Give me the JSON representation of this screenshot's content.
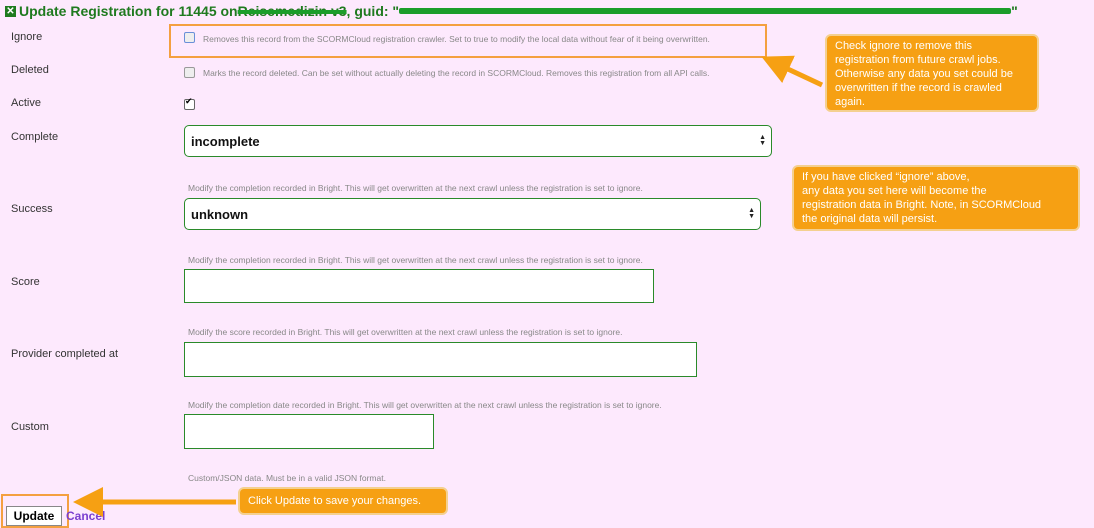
{
  "title": {
    "prefix": "Update Registration for 11445 on ",
    "course": "Reisemedizin v3",
    "guid_label": ", guid: \"",
    "guid_suffix": "\""
  },
  "fields": {
    "ignore": {
      "label": "Ignore",
      "hint": "Removes this record from the SCORMCloud registration crawler. Set to true to modify the local data without fear of it being overwritten.",
      "checked": false
    },
    "deleted": {
      "label": "Deleted",
      "hint": "Marks the record deleted. Can be set without actually deleting the record in SCORMCloud. Removes this registration from all API calls.",
      "checked": false
    },
    "active": {
      "label": "Active",
      "checked": true
    },
    "complete": {
      "label": "Complete",
      "value": "incomplete",
      "hint": "Modify the completion recorded in Bright. This will get overwritten at the next crawl unless the registration is set to ignore."
    },
    "success": {
      "label": "Success",
      "value": "unknown",
      "hint": "Modify the completion recorded in Bright. This will get overwritten at the next crawl unless the registration is set to ignore."
    },
    "score": {
      "label": "Score",
      "value": "",
      "hint": "Modify the score recorded in Bright. This will get overwritten at the next crawl unless the registration is set to ignore."
    },
    "provider_completed_at": {
      "label": "Provider completed at",
      "value": "",
      "hint": "Modify the completion date recorded in Bright. This will get overwritten at the next crawl unless the registration is set to ignore."
    },
    "custom": {
      "label": "Custom",
      "value": "",
      "hint": "Custom/JSON data. Must be in a valid JSON format."
    }
  },
  "actions": {
    "update_label": "Update",
    "cancel_label": "Cancel"
  },
  "callouts": {
    "ignore": "Check ignore to remove this\nregistration from future crawl jobs.\nOtherwise any data you set could be\noverwritten if the record is crawled\nagain.",
    "data": "If you have clicked “ignore” above,\nany data you set here will become the\nregistration data in Bright.   Note, in SCORMCloud\nthe original data will persist.",
    "update": "Click Update to save your changes."
  },
  "colors": {
    "background": "#fde9fd",
    "title": "#1f7a1f",
    "callout": "#f6a013",
    "input_border": "#2a8a2a",
    "cancel_link": "#7b3fd0"
  }
}
